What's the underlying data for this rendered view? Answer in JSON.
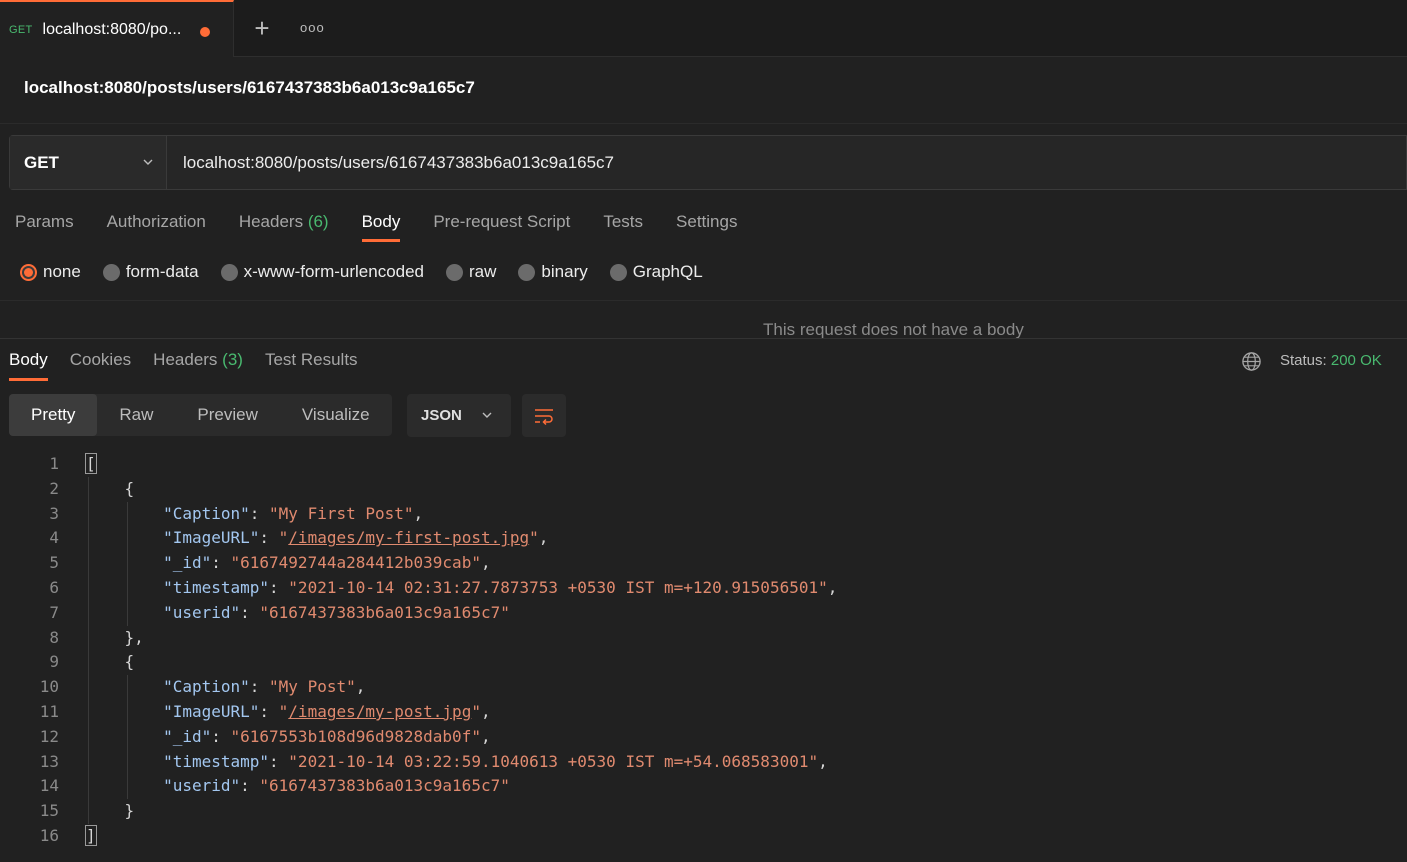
{
  "tab": {
    "method": "GET",
    "title": "localhost:8080/po...",
    "add_icon": "+",
    "more_icon": "ooo"
  },
  "request": {
    "name": "localhost:8080/posts/users/6167437383b6a013c9a165c7",
    "method": "GET",
    "url": "localhost:8080/posts/users/6167437383b6a013c9a165c7"
  },
  "request_tabs": [
    {
      "label": "Params"
    },
    {
      "label": "Authorization"
    },
    {
      "label": "Headers",
      "count": "(6)"
    },
    {
      "label": "Body"
    },
    {
      "label": "Pre-request Script"
    },
    {
      "label": "Tests"
    },
    {
      "label": "Settings"
    }
  ],
  "active_request_tab": "Body",
  "body_types": [
    "none",
    "form-data",
    "x-www-form-urlencoded",
    "raw",
    "binary",
    "GraphQL"
  ],
  "selected_body_type": "none",
  "no_body_message": "This request does not have a body",
  "response_tabs": [
    {
      "label": "Body"
    },
    {
      "label": "Cookies"
    },
    {
      "label": "Headers",
      "count": "(3)"
    },
    {
      "label": "Test Results"
    }
  ],
  "status": {
    "label": "Status:",
    "value": "200 OK"
  },
  "view_modes": [
    "Pretty",
    "Raw",
    "Preview",
    "Visualize"
  ],
  "active_view_mode": "Pretty",
  "format": "JSON",
  "colors": {
    "accent": "#ff6c37",
    "success": "#49b96f",
    "key": "#a3c7f0",
    "string": "#e08a6f"
  },
  "response_body": [
    {
      "Caption": "My First Post",
      "ImageURL": "/images/my-first-post.jpg",
      "_id": "6167492744a284412b039cab",
      "timestamp": "2021-10-14 02:31:27.7873753 +0530 IST m=+120.915056501",
      "userid": "6167437383b6a013c9a165c7"
    },
    {
      "Caption": "My Post",
      "ImageURL": "/images/my-post.jpg",
      "_id": "6167553b108d96d9828dab0f",
      "timestamp": "2021-10-14 03:22:59.1040613 +0530 IST m=+54.068583001",
      "userid": "6167437383b6a013c9a165c7"
    }
  ]
}
